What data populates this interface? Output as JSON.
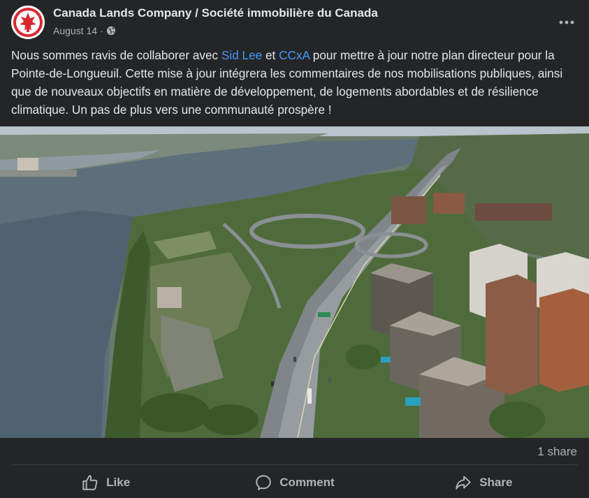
{
  "post": {
    "page_name": "Canada Lands Company / Société immobilière du Canada",
    "date": "August 14",
    "separator": "·",
    "privacy_icon": "globe-icon",
    "more_icon": "more-dots-icon",
    "text": {
      "part1": "Nous sommes ravis de collaborer avec ",
      "link1": "Sid Lee",
      "part2": " et ",
      "link2": "CCxA",
      "part3": " pour mettre à jour notre plan directeur pour la Pointe-de-Longueuil. Cette mise à jour intégrera les commentaires de nos mobilisations publiques, ainsi que de nouveaux objectifs en matière de développement, de logements abordables et de résilience climatique. Un pas de plus vers une communauté prospère !"
    },
    "shares": "1 share"
  },
  "actions": {
    "like": "Like",
    "comment": "Comment",
    "share": "Share"
  },
  "colors": {
    "background": "#242526",
    "text": "#e4e6eb",
    "secondary": "#b0b3b8",
    "link": "#4599ff",
    "logo_red": "#d7282f"
  }
}
